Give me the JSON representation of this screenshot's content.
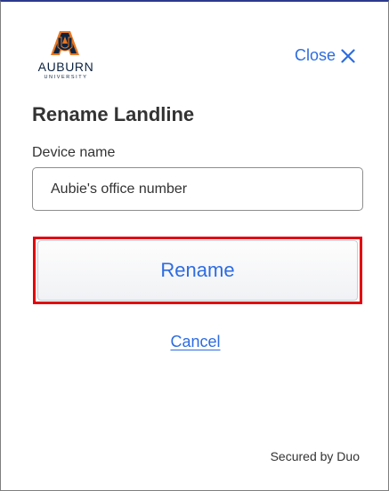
{
  "logo": {
    "name": "AUBURN",
    "sub": "UNIVERSITY",
    "colors": {
      "navy": "#0c2340",
      "orange": "#e87722"
    }
  },
  "header": {
    "close_label": "Close",
    "close_icon": "close-x-icon"
  },
  "dialog": {
    "title": "Rename Landline",
    "field_label": "Device name",
    "field_value": "Aubie's office number",
    "rename_label": "Rename",
    "cancel_label": "Cancel"
  },
  "footer": {
    "secured_by": "Secured by Duo"
  },
  "colors": {
    "link": "#2d6ce0",
    "highlight": "#e3000f",
    "text": "#333333"
  }
}
